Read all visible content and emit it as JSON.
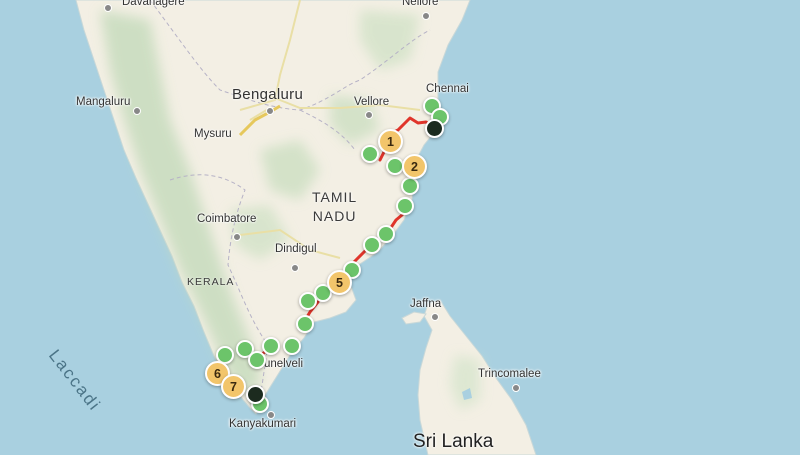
{
  "map": {
    "labels": {
      "davanagere": "Davanagere",
      "nellore": "Nellore",
      "chennai": "Chennai",
      "mangaluru": "Mangaluru",
      "bengaluru": "Bengaluru",
      "vellore": "Vellore",
      "mysuru": "Mysuru",
      "tamil_nadu_line1": "TAMIL",
      "tamil_nadu_line2": "NADU",
      "coimbatore": "Coimbatore",
      "dindigul": "Dindigul",
      "kerala": "KERALA",
      "jaffna": "Jaffna",
      "trincomalee": "Trincomalee",
      "tirunelveli": "unelveli",
      "kanyakumari": "Kanyakumari",
      "sri_lanka": "Sri Lanka",
      "laccadive": "Laccadi"
    },
    "numbered_stops": [
      "1",
      "2",
      "5",
      "6",
      "7"
    ],
    "colors": {
      "water": "#a9d0e0",
      "land": "#f3efe4",
      "stop_marker": "#6cc46a",
      "numbered_marker": "#f2c56b",
      "endpoint_marker": "#1c2b1f",
      "route": "#e0352b"
    }
  }
}
